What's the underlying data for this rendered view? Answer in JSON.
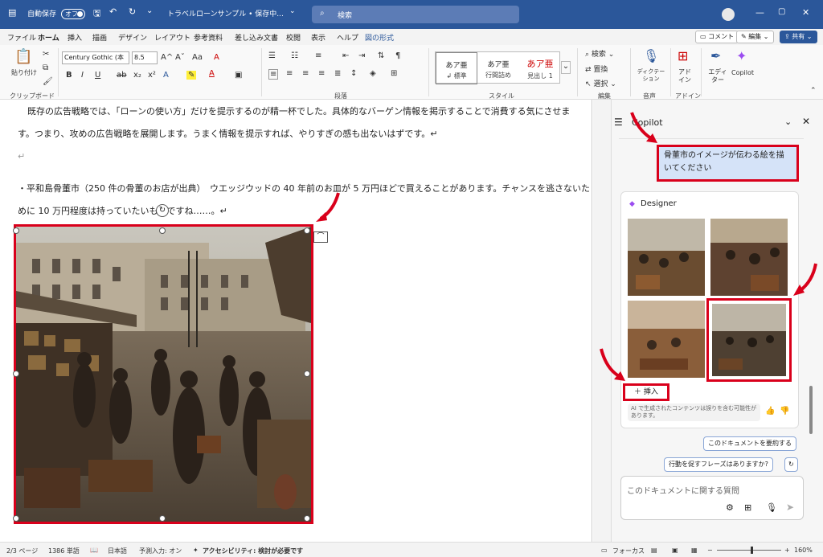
{
  "titlebar": {
    "autosave_label": "自動保存",
    "autosave_state": "オフ",
    "doc_title": "トラベルローンサンプル • 保存中...",
    "search_placeholder": "検索",
    "min_icon": "minimize-icon",
    "max_icon": "maximize-icon",
    "close_icon": "close-icon"
  },
  "menu": {
    "items": [
      "ファイル",
      "ホーム",
      "挿入",
      "描画",
      "デザイン",
      "レイアウト",
      "参考資料",
      "差し込み文書",
      "校閲",
      "表示",
      "ヘルプ",
      "図の形式"
    ],
    "comment": "コメント",
    "edit": "編集",
    "share": "共有"
  },
  "ribbon": {
    "clipboard": {
      "paste": "貼り付け",
      "label": "クリップボード"
    },
    "font": {
      "name": "Century Gothic (本",
      "size": "8.5",
      "bold": "B",
      "italic": "I",
      "underline": "U",
      "strike": "ab",
      "sub": "x₂",
      "sup": "x²",
      "grow": "A^",
      "shrink": "Aˇ",
      "case": "Aa",
      "clear": "A"
    },
    "paragraph_label": "段落",
    "styles": {
      "label": "スタイル",
      "items": [
        {
          "a": "あア亜",
          "b": "↲ 標準"
        },
        {
          "a": "あア亜",
          "b": "行間詰め"
        },
        {
          "a": "あア亜",
          "b": "見出し 1"
        }
      ]
    },
    "editing": {
      "find": "検索",
      "replace": "置換",
      "select": "選択",
      "label": "編集"
    },
    "voice": {
      "dictate": "ディクテーション",
      "label": "音声"
    },
    "addin": {
      "addin": "アドイン",
      "label": "アドイン"
    },
    "editor": "エディター",
    "copilot": "Copilot"
  },
  "document": {
    "line1": "既存の広告戦略では、「ローンの使い方」だけを提示するのが精一杯でした。具体的なバーゲン情報を掲示することで消費する気にさせま",
    "line2": "す。つまり、攻めの広告戦略を展開します。うまく情報を提示すれば、やりすぎの感も出ないはずです。↵",
    "line3": "↵",
    "line4": "・平和島骨董市（250 件の骨董のお店が出典）　ウエッジウッドの 40 年前のお皿が 5 万円ほどで買えることがあります。チャンスを逃さないた",
    "line5": "めに 10 万円程度は持っていたいものですね……。↵"
  },
  "copilot": {
    "title": "Copilot",
    "user_prompt": "骨董市のイメージが伝わる絵を描いてください",
    "designer": "Designer",
    "insert": "挿入",
    "disclaimer": "AI で生成されたコンテンツは誤りを含む可能性があります。",
    "suggestion1": "このドキュメントを要約する",
    "suggestion2": "行動を促すフレーズはありますか?",
    "ask_placeholder": "このドキュメントに関する質問"
  },
  "status": {
    "page": "2/3 ページ",
    "words": "1386 単語",
    "lang": "日本語",
    "predict": "予測入力: オン",
    "access": "アクセシビリティ: 検討が必要です",
    "focus": "フォーカス",
    "zoom": "160%"
  },
  "colors": {
    "accent": "#2b579a",
    "highlight": "#d9001b",
    "bubble": "#d5e3f8"
  }
}
